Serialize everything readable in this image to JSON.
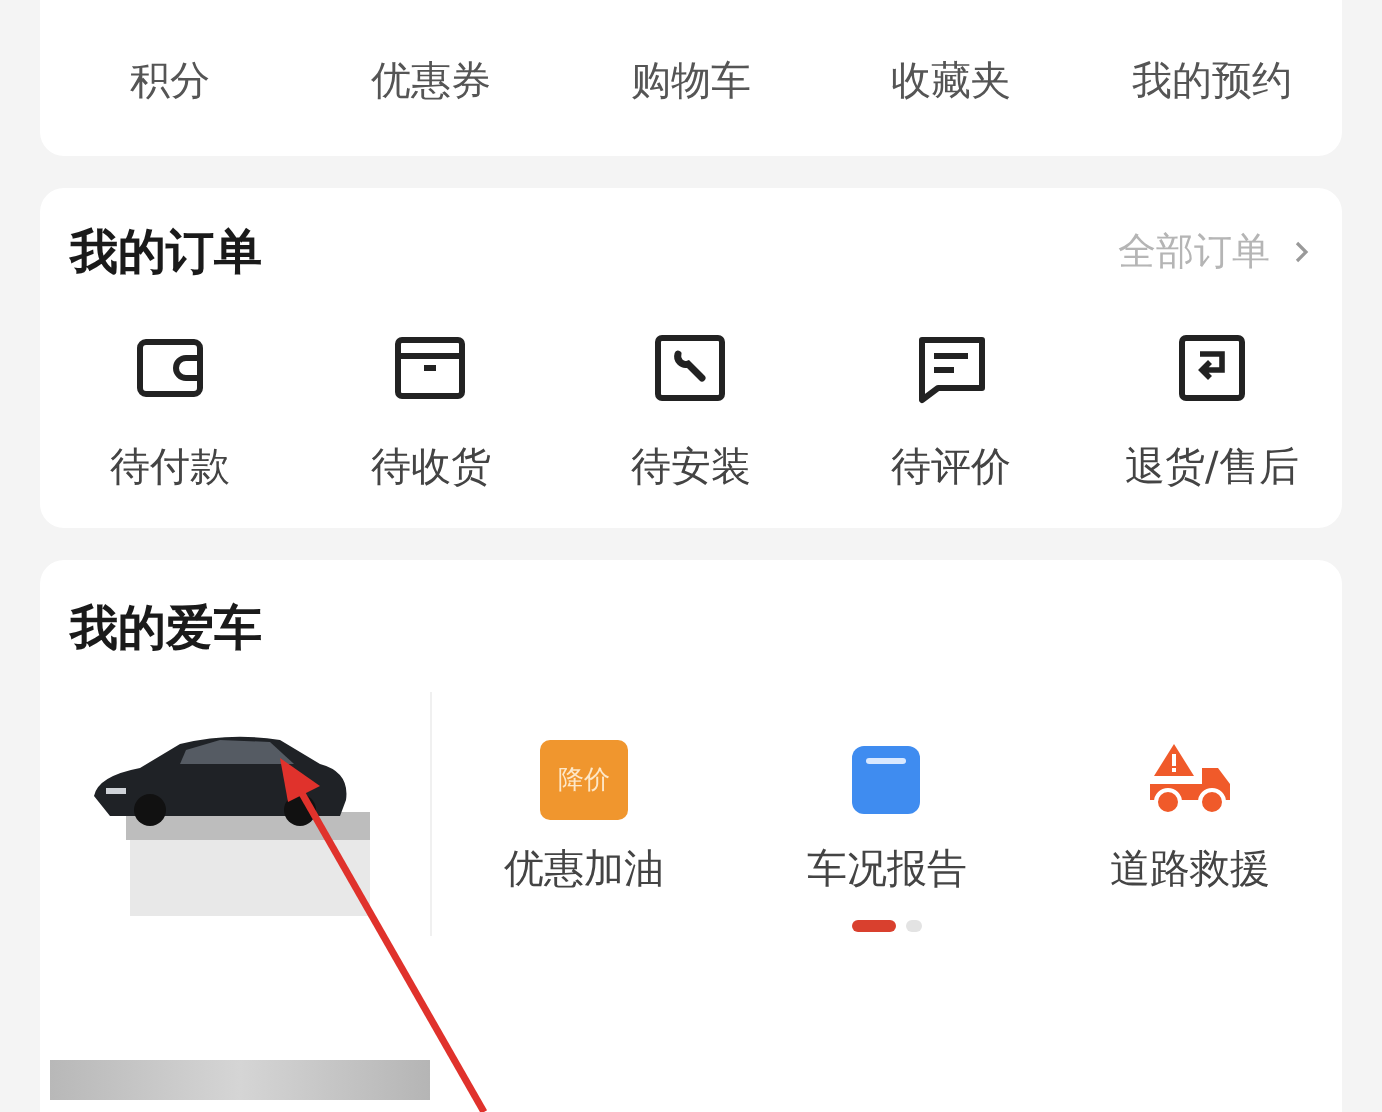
{
  "shortcuts": [
    {
      "label": "积分"
    },
    {
      "label": "优惠券"
    },
    {
      "label": "购物车"
    },
    {
      "label": "收藏夹"
    },
    {
      "label": "我的预约"
    }
  ],
  "orders": {
    "title": "我的订单",
    "all_link": "全部订单",
    "items": [
      {
        "kind": "wallet",
        "label": "待付款"
      },
      {
        "kind": "box",
        "label": "待收货"
      },
      {
        "kind": "wrench",
        "label": "待安装"
      },
      {
        "kind": "comment",
        "label": "待评价"
      },
      {
        "kind": "return",
        "label": "退货/售后"
      }
    ]
  },
  "car": {
    "title": "我的爱车",
    "services": [
      {
        "kind": "fuel",
        "badge": "降价",
        "label": "优惠加油"
      },
      {
        "kind": "report",
        "label": "车况报告"
      },
      {
        "kind": "rescue",
        "label": "道路救援"
      }
    ],
    "pages": [
      {
        "selected": true
      },
      {
        "selected": false
      }
    ]
  }
}
